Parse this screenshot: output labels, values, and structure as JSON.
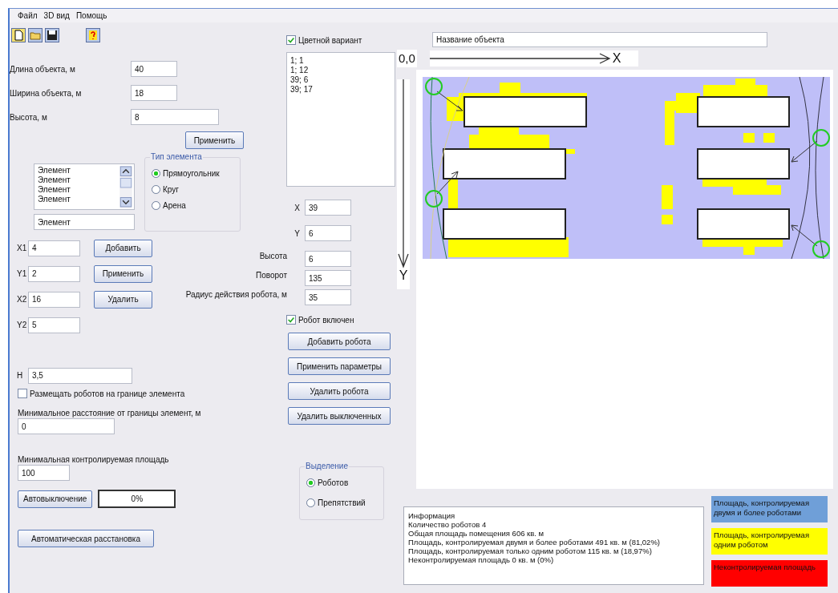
{
  "menu": [
    {
      "label": "Файл"
    },
    {
      "label": "3D вид"
    },
    {
      "label": "Помощь"
    }
  ],
  "object": {
    "fields": [
      {
        "label": "Длина объекта, м",
        "value": "40"
      },
      {
        "label": "Ширина объекта, м",
        "value": "18"
      },
      {
        "label": "Высота, м",
        "value": "8"
      }
    ],
    "apply_button": "Применить"
  },
  "elements": {
    "items": [
      "Элемент",
      "Элемент",
      "Элемент",
      "Элемент"
    ],
    "name_value": "Элемент",
    "type_group": {
      "title": "Тип элемента",
      "options": [
        {
          "label": "Прямоугольник",
          "selected": true
        },
        {
          "label": "Круг",
          "selected": false
        },
        {
          "label": "Арена",
          "selected": false
        }
      ]
    },
    "coords": [
      {
        "label": "X1",
        "value": "4"
      },
      {
        "label": "Y1",
        "value": "2"
      },
      {
        "label": "X2",
        "value": "16"
      },
      {
        "label": "Y2",
        "value": "5"
      }
    ],
    "buttons": [
      "Добавить",
      "Применить",
      "Удалить"
    ],
    "h": {
      "label": "H",
      "value": "3,5"
    },
    "place_on_border": {
      "label": "Размещать роботов на границе элемента",
      "checked": false
    },
    "min_distance": {
      "label": "Минимальное расстояние от границы элемент, м",
      "value": "0"
    }
  },
  "min_area": {
    "label": "Минимальная контролируемая площадь",
    "value": "100"
  },
  "auto_off": {
    "button": "Автовыключение",
    "progress": "0%"
  },
  "auto_place_button": "Автоматическая расстановка",
  "robots": {
    "color_variant": {
      "label": "Цветной вариант",
      "checked": true
    },
    "list": [
      "1; 1",
      "1; 12",
      "39; 6",
      "39; 17"
    ],
    "fields": [
      {
        "label": "X",
        "value": "39",
        "kind": "coordinate"
      },
      {
        "label": "Y",
        "value": "6",
        "kind": "coordinate"
      },
      {
        "label": "Высота",
        "value": "6",
        "kind": "parameter"
      },
      {
        "label": "Поворот",
        "value": "135",
        "kind": "parameter"
      },
      {
        "label": "Радиус действия робота, м",
        "value": "35",
        "kind": "parameter"
      }
    ],
    "enabled": {
      "label": "Робот включен",
      "checked": true
    },
    "buttons": [
      "Добавить робота",
      "Применить параметры",
      "Удалить робота",
      "Удалить выключенных"
    ]
  },
  "selection": {
    "title": "Выделение",
    "options": [
      {
        "label": "Роботов",
        "selected": true
      },
      {
        "label": "Препятствий",
        "selected": false
      }
    ]
  },
  "plan": {
    "name_value": "Название объекта",
    "origin_label": "0,0",
    "x_label": "X",
    "y_label": "Y"
  },
  "info": {
    "lines": [
      "Информация",
      "Количество роботов 4",
      "Общая площадь помещения 606 кв. м",
      "Площадь, контролируемая двумя и более роботами 491 кв. м (81,02%)",
      "Площадь, контролируемая только одним роботом 115 кв. м (18,97%)",
      "Неконтролируемая площадь 0 кв. м (0%)"
    ]
  },
  "legend": [
    {
      "label": "Площадь, контролируемая двумя и более роботами",
      "color": "#6f9fd8"
    },
    {
      "label": "Площадь, контролируемая одним роботом",
      "color": "#ffff00"
    },
    {
      "label": "Неконтролируемая площадь",
      "color": "#ff0000"
    }
  ]
}
